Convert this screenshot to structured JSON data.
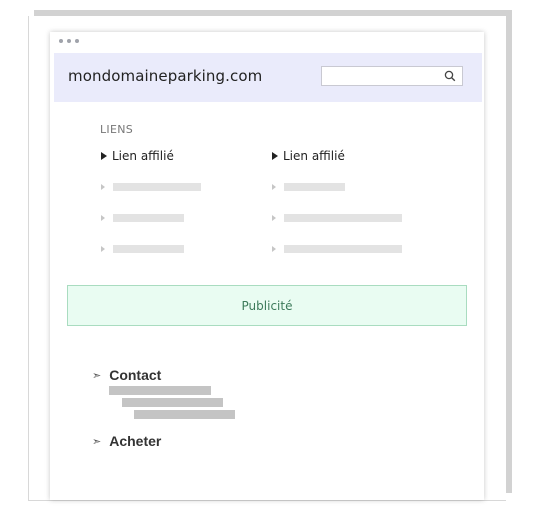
{
  "header": {
    "domain": "mondomaineparking.com",
    "search": {
      "placeholder": "",
      "icon": "search-icon"
    }
  },
  "links": {
    "title": "LIENS",
    "items": [
      {
        "label": "Lien affilié"
      },
      {
        "label": "Lien affilié"
      }
    ]
  },
  "ad": {
    "label": "Publicité"
  },
  "sections": [
    {
      "label": "Contact"
    },
    {
      "label": "Acheter"
    }
  ],
  "colors": {
    "header_bg": "#eaebfb",
    "ad_bg": "#e9fcf2",
    "ad_border": "#a9dcc0",
    "ad_text": "#3c7a5a"
  }
}
